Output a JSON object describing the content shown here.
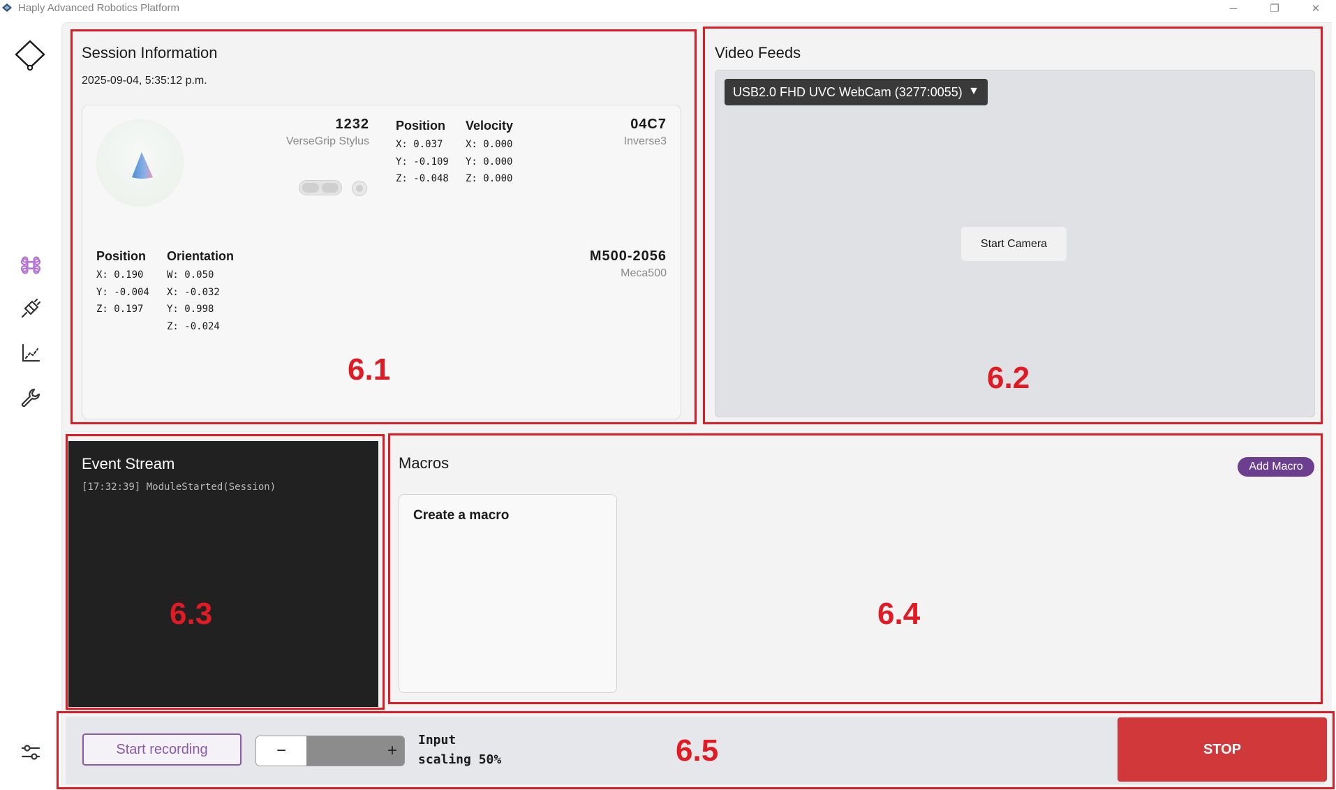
{
  "window": {
    "title": "Haply Advanced Robotics Platform",
    "minimize": "─",
    "maximize": "❐",
    "close": "✕"
  },
  "sidebar": {
    "items": [
      {
        "icon": "diamond-logo-icon"
      },
      {
        "icon": "command-icon",
        "active": true,
        "color": "#b374d6"
      },
      {
        "icon": "plug-icon"
      },
      {
        "icon": "chart-icon"
      },
      {
        "icon": "wrench-icon"
      },
      {
        "icon": "sliders-icon"
      }
    ]
  },
  "session": {
    "title": "Session Information",
    "date": "2025-09-04, 5:35:12 p.m.",
    "stylus": {
      "id": "1232",
      "type": "VerseGrip Stylus"
    },
    "inverse": {
      "id": "04C7",
      "type": "Inverse3",
      "position_head": "Position",
      "position": "X: 0.037\nY: -0.109\nZ: -0.048",
      "velocity_head": "Velocity",
      "velocity": "X: 0.000\nY: 0.000\nZ: 0.000"
    },
    "meca": {
      "id": "M500-2056",
      "type": "Meca500",
      "position_head": "Position",
      "position": "X: 0.190\nY: -0.004\nZ: 0.197",
      "orientation_head": "Orientation",
      "orientation": "W: 0.050\nX: -0.032\nY: 0.998\nZ: -0.024"
    }
  },
  "video": {
    "title": "Video Feeds",
    "camera": "USB2.0 FHD UVC WebCam (3277:0055)",
    "caret": "▼",
    "start": "Start Camera"
  },
  "events": {
    "title": "Event Stream",
    "lines": [
      "[17:32:39] ModuleStarted(Session)"
    ]
  },
  "macros": {
    "title": "Macros",
    "add": "Add Macro",
    "card_title": "Create a macro"
  },
  "controls": {
    "record": "Start recording",
    "minus": "−",
    "plus": "+",
    "scaling_label": "Input",
    "scaling_value": "scaling 50%",
    "scaling_percent": 50,
    "stop": "STOP"
  },
  "annotations": {
    "s61": "6.1",
    "s62": "6.2",
    "s63": "6.3",
    "s64": "6.4",
    "s65": "6.5"
  },
  "colors": {
    "accent": "#6b3e8f",
    "stop": "#d0383a",
    "annotation": "#e01b24"
  }
}
